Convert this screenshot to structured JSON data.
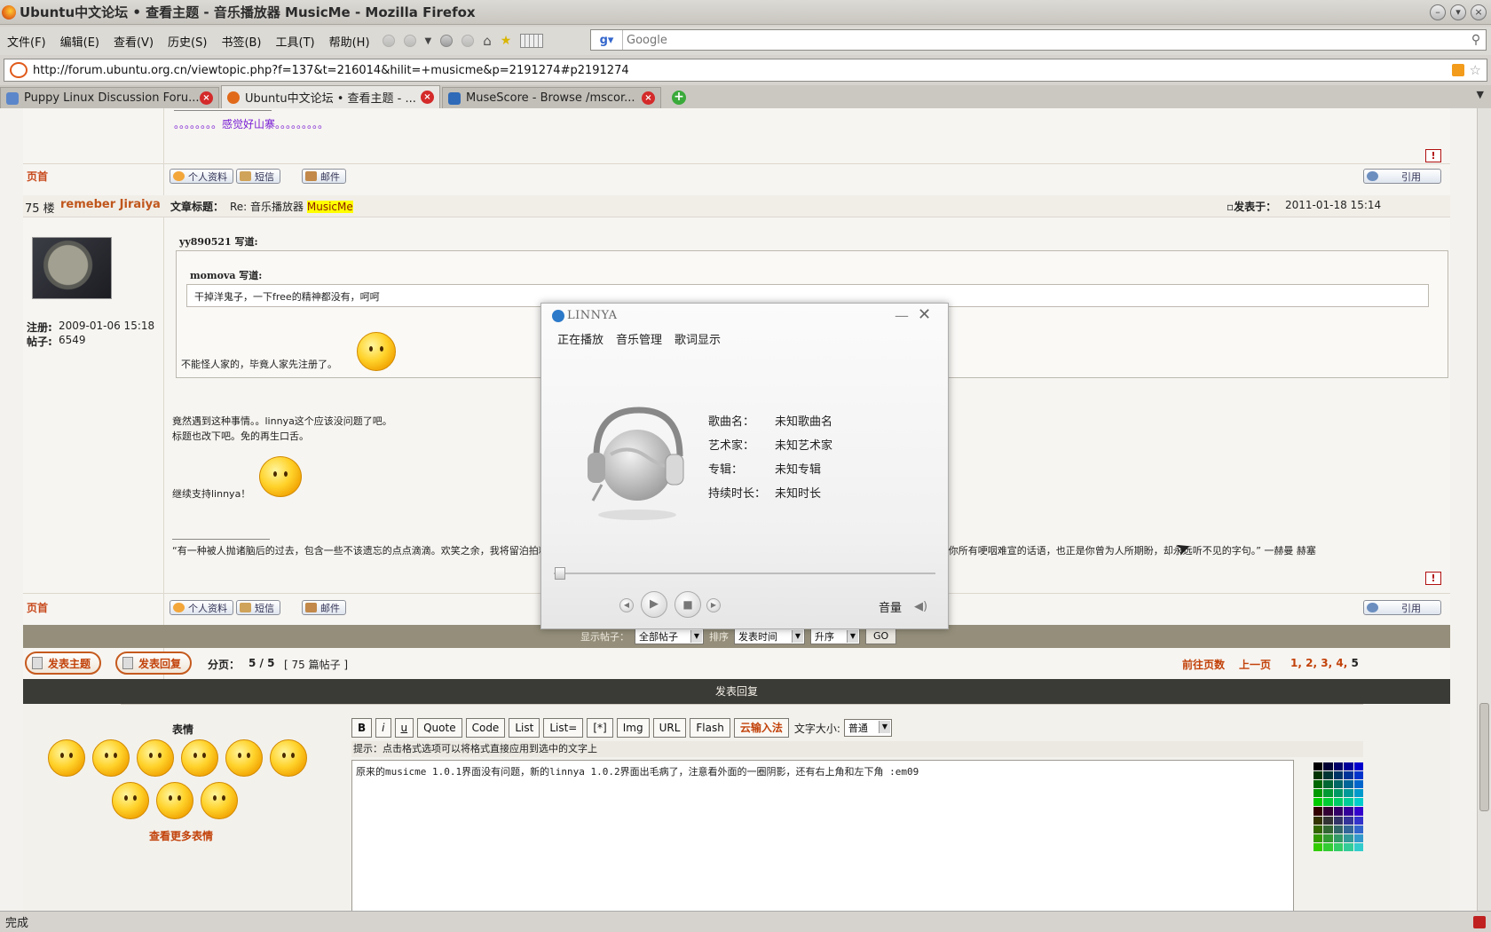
{
  "window": {
    "title": "Ubuntu中文论坛 • 查看主题 - 音乐播放器 MusicMe - Mozilla Firefox"
  },
  "menu": [
    "文件(F)",
    "编辑(E)",
    "查看(V)",
    "历史(S)",
    "书签(B)",
    "工具(T)",
    "帮助(H)"
  ],
  "search": {
    "placeholder": "Google"
  },
  "url": "http://forum.ubuntu.org.cn/viewtopic.php?f=137&t=216014&hilit=+musicme&p=2191274#p2191274",
  "tabs": [
    {
      "label": "Puppy Linux Discussion Foru..."
    },
    {
      "label": "Ubuntu中文论坛 • 查看主题 - ..."
    },
    {
      "label": "MuseScore - Browse /mscor..."
    }
  ],
  "prev_post": {
    "sig_link": "。。。。。。。。感觉好山寨。。。。。。。。。",
    "top_link": "页首"
  },
  "post_buttons": {
    "profile": "个人资料",
    "pm": "短信",
    "email": "邮件",
    "quote": "引用"
  },
  "post": {
    "floor": "75 楼",
    "author": "remeber Jiraiya",
    "subject_label": "文章标题：",
    "subject": "Re: 音乐播放器 ",
    "subject_highlight": "MusicMe",
    "time_label": "发表于：",
    "time": "2011-01-18 15:14",
    "reg_label": "注册:",
    "reg_date": "2009-01-06 15:18",
    "posts_label": "帖子:",
    "posts_count": "6549",
    "quote_outer_name": "yy890521 写道:",
    "quote_inner_name": "momova 写道:",
    "quote_inner_text": "干掉洋鬼子，一下free的精神都没有，呵呵",
    "quote_outer_text": "不能怪人家的，毕竟人家先注册了。",
    "body_line1": "竟然遇到这种事情。。linnya这个应该没问题了吧。",
    "body_line2": "标题也改下吧。免的再生口舌。",
    "body_line3": "继续支持linnya！",
    "signature": "“有一种被人抛诸脑后的过去，包含一些不该遗忘的点点滴滴。欢笑之余，我将留泊拍粘，才剩见自己的嘴情。人世间似乎存在着某种公平，每个人都曾被抛弃在他人的遗忘中；而今你所有哽咽难宣的话语，也正是你曾为人所期盼，却永远听不见的字句。” 一赫曼 赫塞",
    "top_link": "页首"
  },
  "bottom_bar": {
    "show_label": "显示帖子：",
    "show_value": "全部帖子",
    "sort_label": "排序",
    "sort_value": "发表时间",
    "order_value": "升序",
    "go": "GO"
  },
  "nav": {
    "new_topic": "发表主题",
    "reply": "发表回复",
    "pager_label": "分页：",
    "pager_value": "5 / 5",
    "pager_count": "[ 75 篇帖子 ]",
    "goto": "前往页数",
    "prev": "上一页",
    "pages": [
      "1",
      "2",
      "3",
      "4",
      "5"
    ]
  },
  "reply": {
    "bar_title": "发表回复",
    "emote_title": "表情",
    "more_emotes": "查看更多表情",
    "fmt_buttons": [
      "B",
      "i",
      "u",
      "Quote",
      "Code",
      "List",
      "List=",
      "[*]",
      "Img",
      "URL",
      "Flash"
    ],
    "cloud_ime": "云输入法",
    "fontsize_label": "文字大小:",
    "fontsize_value": "普通",
    "hint": "提示：点击格式选项可以将格式直接应用到选中的文字上",
    "text": "原来的musicme 1.0.1界面没有问题，新的linnya 1.0.2界面出毛病了，注意看外面的一圈阴影，还有右上角和左下角 :em09"
  },
  "player": {
    "logo": "LINNYA",
    "tabs": [
      "正在播放",
      "音乐管理",
      "歌词显示"
    ],
    "info": [
      {
        "k": "歌曲名：",
        "v": "未知歌曲名"
      },
      {
        "k": "艺术家：",
        "v": "未知艺术家"
      },
      {
        "k": "专辑：",
        "v": "未知专辑"
      },
      {
        "k": "持续时长：",
        "v": "未知时长"
      }
    ],
    "volume_label": "音量"
  },
  "status": "完成"
}
